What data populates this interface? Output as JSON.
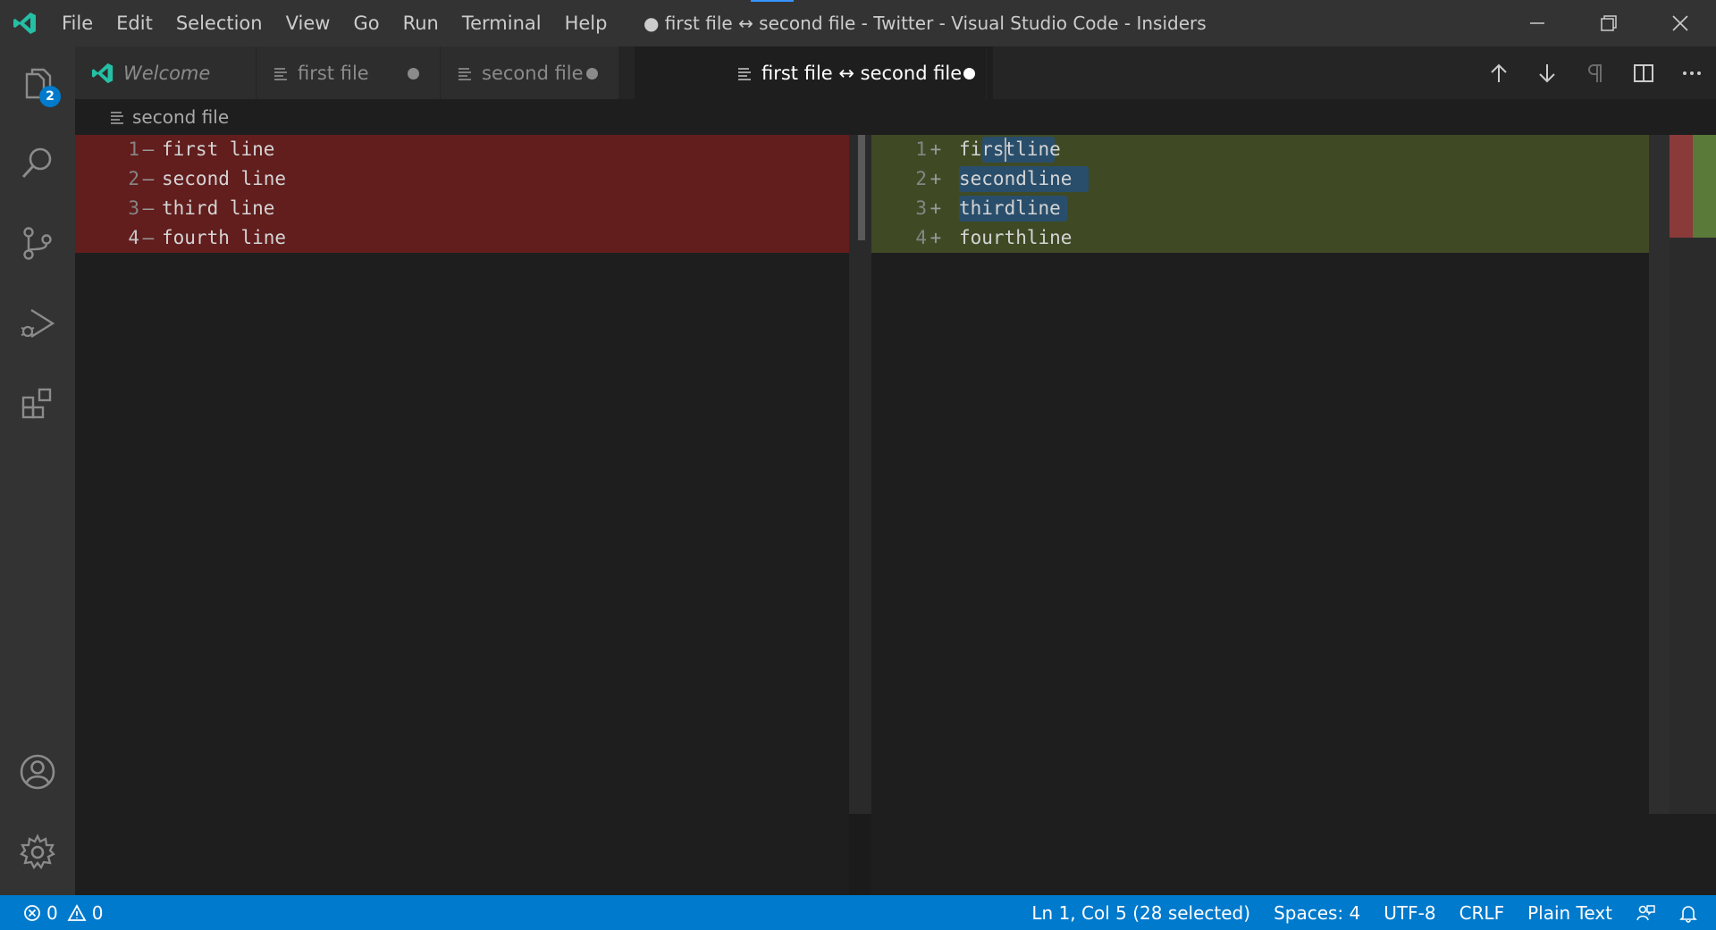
{
  "window": {
    "title": "● first file ↔ second file - Twitter - Visual Studio Code - Insiders"
  },
  "menu": [
    "File",
    "Edit",
    "Selection",
    "View",
    "Go",
    "Run",
    "Terminal",
    "Help"
  ],
  "activity": {
    "explorer_badge": "2"
  },
  "tabs": [
    {
      "label": "Welcome",
      "dirty": false,
      "active": false
    },
    {
      "label": "first file",
      "dirty": true,
      "active": false
    },
    {
      "label": "second file",
      "dirty": true,
      "active": false
    },
    {
      "label": "first file ↔ second file",
      "dirty": true,
      "active": true
    }
  ],
  "breadcrumb": {
    "label": "second file"
  },
  "diff": {
    "left": [
      {
        "num": "1",
        "sign": "—",
        "text": "first line"
      },
      {
        "num": "2",
        "sign": "—",
        "text": "second line"
      },
      {
        "num": "3",
        "sign": "—",
        "text": "third line"
      },
      {
        "num": "4",
        "sign": "—",
        "text": "fourth line"
      }
    ],
    "right": [
      {
        "num": "1",
        "sign": "+",
        "text": "firstline"
      },
      {
        "num": "2",
        "sign": "+",
        "text": "secondline"
      },
      {
        "num": "3",
        "sign": "+",
        "text": "thirdline"
      },
      {
        "num": "4",
        "sign": "+",
        "text": "fourthline"
      }
    ]
  },
  "status": {
    "errors": "0",
    "warnings": "0",
    "position": "Ln 1, Col 5 (28 selected)",
    "spaces": "Spaces: 4",
    "encoding": "UTF-8",
    "eol": "CRLF",
    "language": "Plain Text"
  },
  "colors": {
    "accent": "#007acc",
    "removed": "#9b1e1e",
    "inserted": "#4b5a28"
  }
}
